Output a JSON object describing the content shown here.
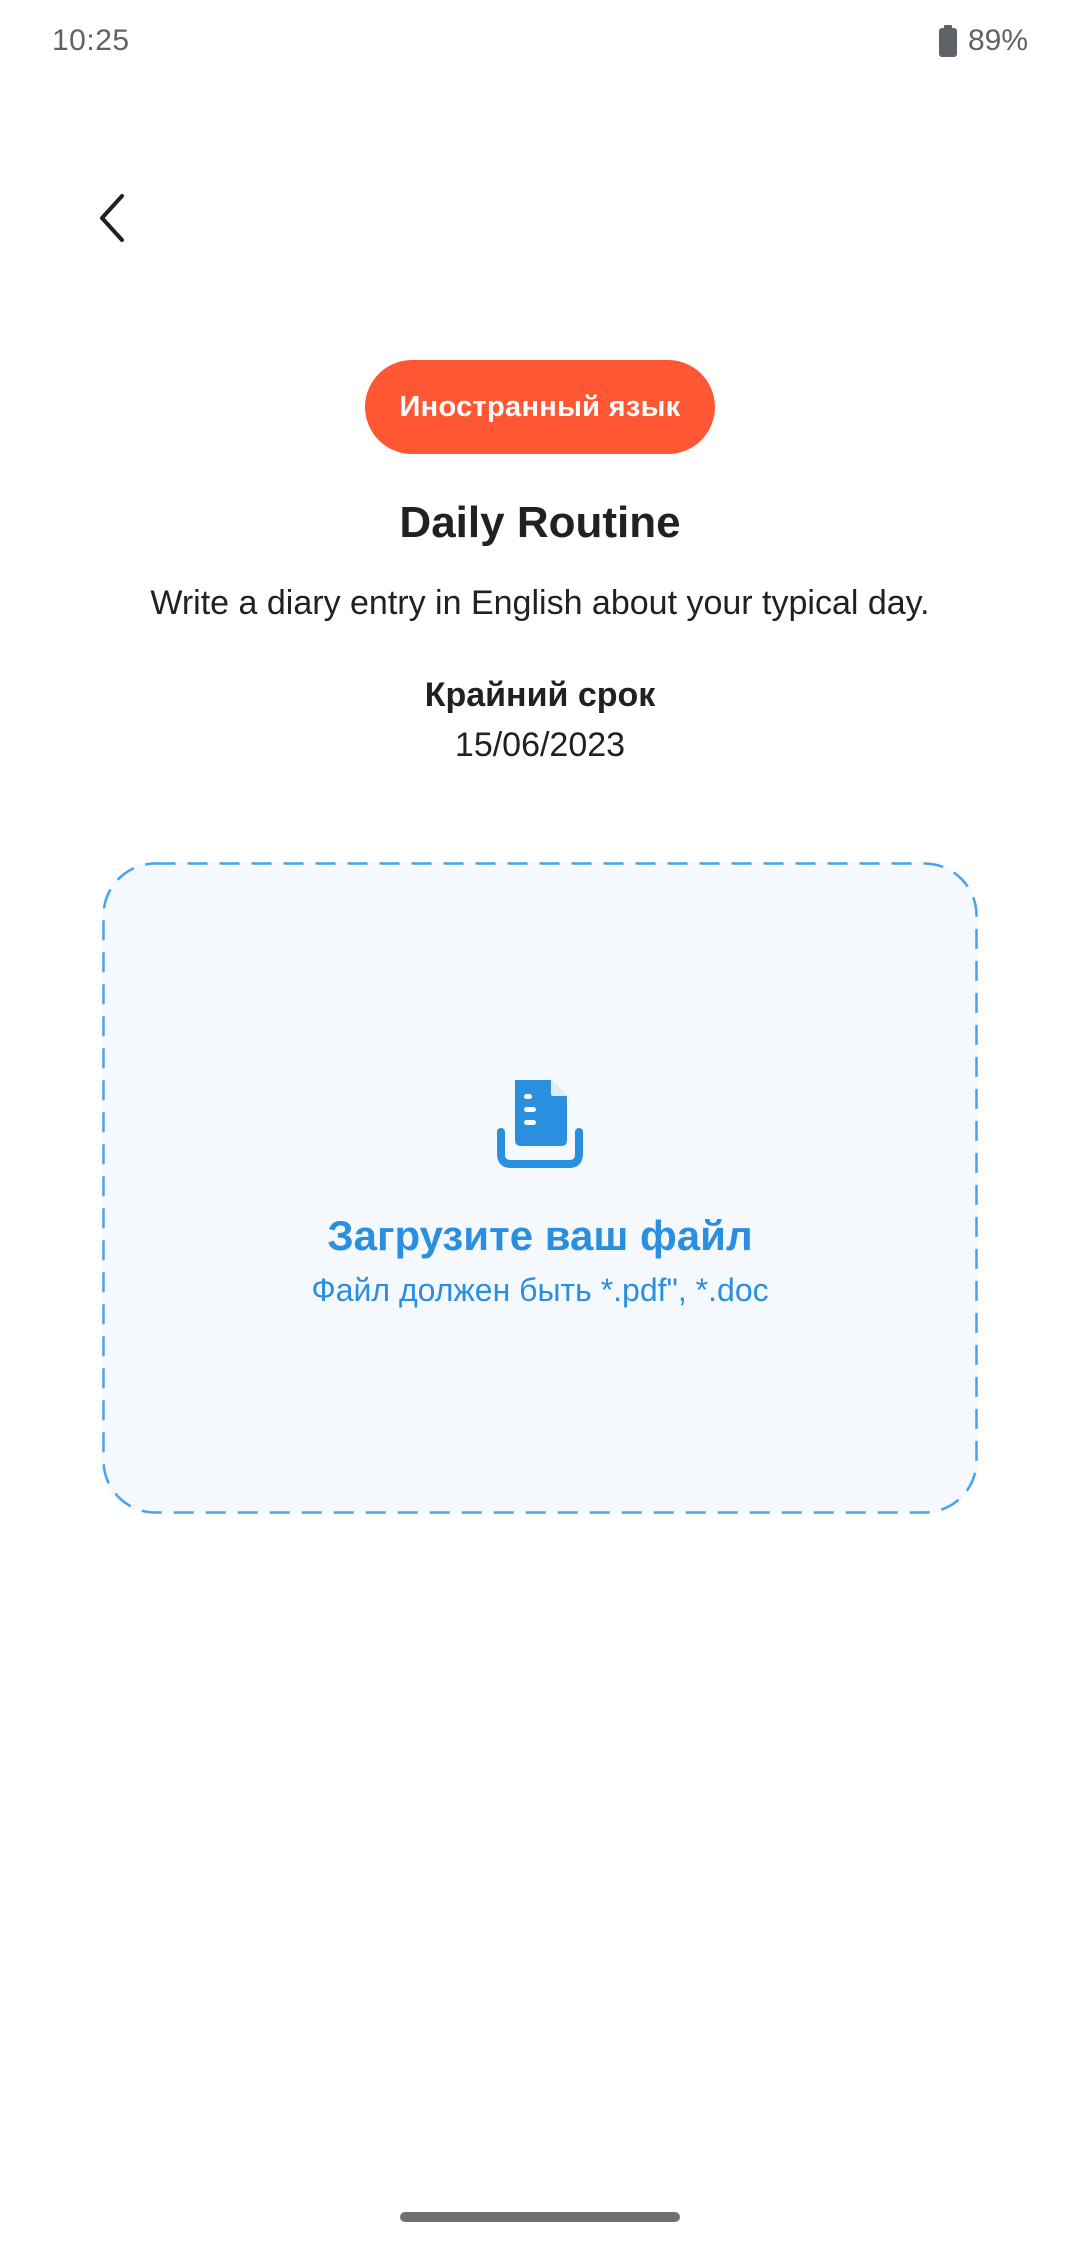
{
  "status_bar": {
    "time": "10:25",
    "battery": "89%",
    "battery_icon": "battery-icon"
  },
  "navigation": {
    "back_icon": "chevron-left-icon"
  },
  "assignment": {
    "subject": "Иностранный язык",
    "title": "Daily Routine",
    "description": "Write a diary entry in English about your typical day.",
    "deadline_label": "Крайний срок",
    "deadline": "15/06/2023"
  },
  "upload": {
    "icon": "document-upload-icon",
    "title": "Загрузите ваш файл",
    "hint": "Файл должен быть *.pdf\", *.doc"
  },
  "colors": {
    "subject_pill": "#ff5733",
    "accent": "#2b8fe0",
    "upload_background": "#f5f9fd"
  }
}
